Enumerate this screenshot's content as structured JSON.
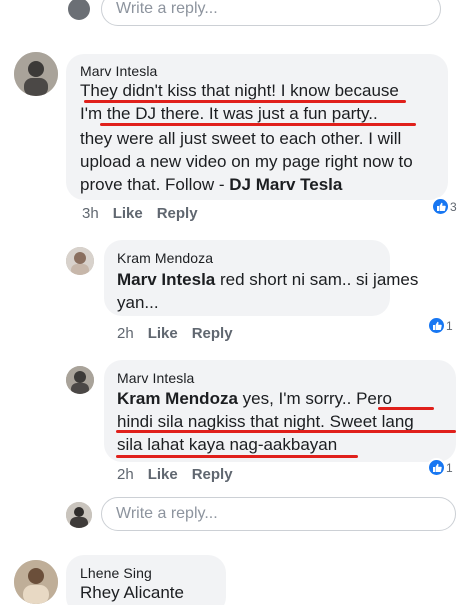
{
  "top_reply": {
    "placeholder": "Write a reply..."
  },
  "comment1": {
    "author": "Marv Intesla",
    "lines": [
      "They didn't kiss that night! I know because",
      "I'm the DJ there. It was just a fun party..",
      "they were all just sweet to each other. I will",
      "upload a new video on my page right now to",
      "prove that. Follow - "
    ],
    "line5_bold": "DJ Marv Tesla",
    "time": "3h",
    "like": "Like",
    "reply": "Reply",
    "reactions": "3"
  },
  "reply1": {
    "author": "Kram Mendoza",
    "tag": "Marv Intesla",
    "line1_rest": " red short ni sam.. si james",
    "line2": "yan...",
    "time": "2h",
    "like": "Like",
    "reply": "Reply",
    "reactions": "1"
  },
  "reply2": {
    "author": "Marv Intesla",
    "tag": "Kram Mendoza",
    "line1_rest": " yes, I'm sorry.. Pero",
    "line2": "hindi sila nagkiss that night. Sweet lang",
    "line3": "sila lahat kaya nag-aakbayan",
    "time": "2h",
    "like": "Like",
    "reply": "Reply",
    "reactions": "1"
  },
  "bottom_reply": {
    "placeholder": "Write a reply..."
  },
  "comment2": {
    "author": "Lhene Sing",
    "tag": "Rhey Alicante"
  },
  "colors": {
    "accent": "#1877f2",
    "link": "#385898",
    "underline": "#e0201b"
  }
}
